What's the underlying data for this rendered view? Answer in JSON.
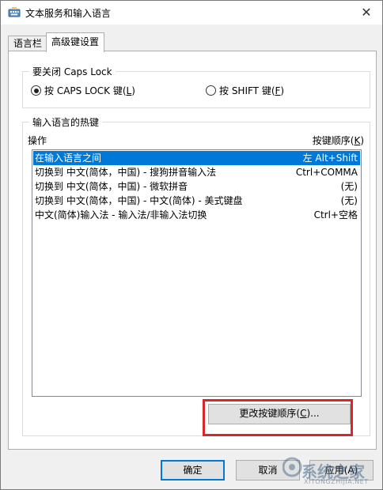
{
  "window": {
    "title": "文本服务和输入语言",
    "close_glyph": "✕"
  },
  "tabs": [
    {
      "label": "语言栏"
    },
    {
      "label": "高级键设置"
    }
  ],
  "caps_group": {
    "title": "要关闭 Caps Lock",
    "options": [
      {
        "label": "按 CAPS LOCK 键(",
        "key": "L",
        "suffix": ")",
        "checked": true
      },
      {
        "label": "按 SHIFT 键(",
        "key": "F",
        "suffix": ")",
        "checked": false
      }
    ]
  },
  "hotkey_group": {
    "title": "输入语言的热键",
    "col_action": "操作",
    "col_sequence_label": "按键顺序(",
    "col_sequence_key": "K",
    "col_sequence_suffix": ")",
    "rows": [
      {
        "action": "在输入语言之间",
        "keys": "左 Alt+Shift",
        "selected": true
      },
      {
        "action": "切换到 中文(简体，中国) - 搜狗拼音输入法",
        "keys": "Ctrl+COMMA",
        "selected": false
      },
      {
        "action": "切换到 中文(简体，中国) - 微软拼音",
        "keys": "(无)",
        "selected": false
      },
      {
        "action": "切换到 中文(简体，中国) - 中文(简体) - 美式键盘",
        "keys": "(无)",
        "selected": false
      },
      {
        "action": "中文(简体)输入法 - 输入法/非输入法切换",
        "keys": "Ctrl+空格",
        "selected": false
      }
    ],
    "change_button": {
      "label": "更改按键顺序(",
      "key": "C",
      "suffix": ")..."
    }
  },
  "footer": {
    "ok_label": "确定",
    "cancel_label": "取消",
    "apply_label": "应用(A)"
  },
  "watermark": {
    "brand": "系统之家",
    "sub": "XITONGZHIJIA.NET"
  },
  "colors": {
    "selection": "#0078d7",
    "highlight_box": "#d9262b"
  }
}
